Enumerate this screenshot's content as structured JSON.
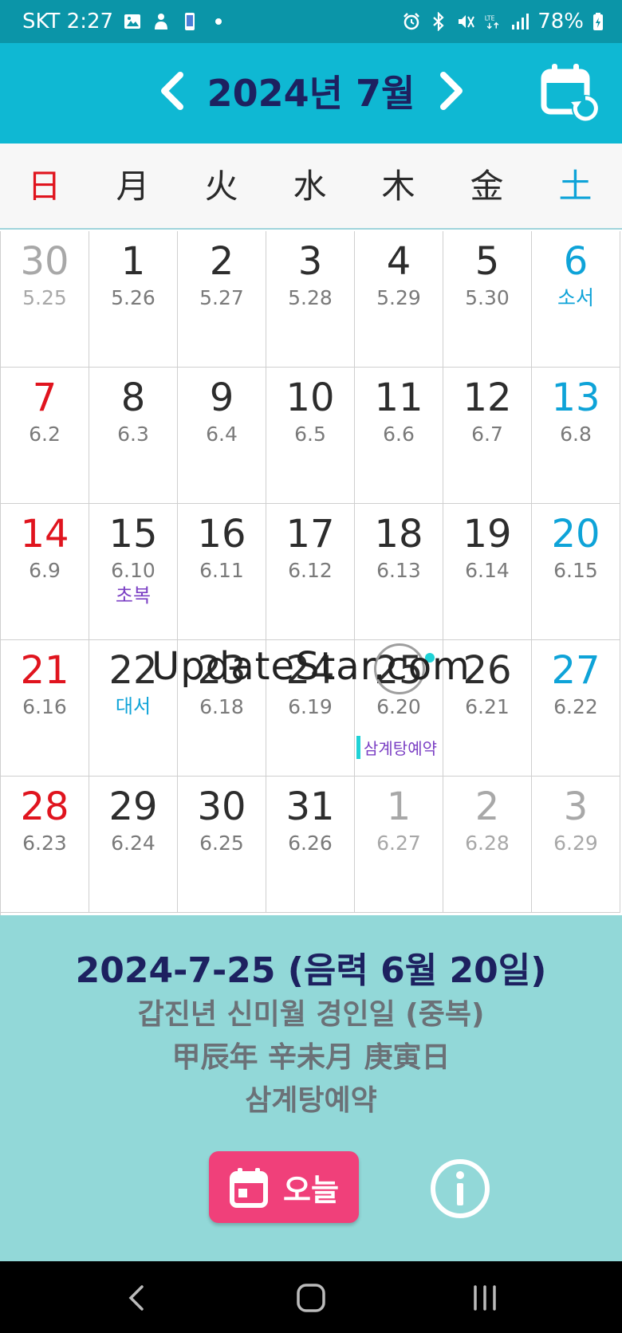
{
  "status_bar": {
    "carrier_time": "SKT 2:27",
    "left_icons": [
      "image-icon",
      "notification-icon",
      "phone-icon",
      "dot-icon"
    ],
    "right_icons": [
      "alarm-icon",
      "bluetooth-icon",
      "mute-icon",
      "lte-icon",
      "signal-icon"
    ],
    "battery": "78%"
  },
  "header": {
    "month_title": "2024년 7월"
  },
  "weekdays": [
    "日",
    "月",
    "火",
    "水",
    "木",
    "金",
    "土"
  ],
  "weeks": [
    [
      {
        "day": "30",
        "lunar": "5.25",
        "type": "other"
      },
      {
        "day": "1",
        "lunar": "5.26"
      },
      {
        "day": "2",
        "lunar": "5.27"
      },
      {
        "day": "3",
        "lunar": "5.28"
      },
      {
        "day": "4",
        "lunar": "5.29"
      },
      {
        "day": "5",
        "lunar": "5.30"
      },
      {
        "day": "6",
        "lunar": "소서",
        "type": "sat",
        "lunar_style": "festival"
      }
    ],
    [
      {
        "day": "7",
        "lunar": "6.2",
        "type": "sun"
      },
      {
        "day": "8",
        "lunar": "6.3"
      },
      {
        "day": "9",
        "lunar": "6.4"
      },
      {
        "day": "10",
        "lunar": "6.5"
      },
      {
        "day": "11",
        "lunar": "6.6"
      },
      {
        "day": "12",
        "lunar": "6.7"
      },
      {
        "day": "13",
        "lunar": "6.8",
        "type": "sat"
      }
    ],
    [
      {
        "day": "14",
        "lunar": "6.9",
        "type": "sun"
      },
      {
        "day": "15",
        "lunar": "6.10",
        "note": "초복",
        "note_color": "purple"
      },
      {
        "day": "16",
        "lunar": "6.11"
      },
      {
        "day": "17",
        "lunar": "6.12"
      },
      {
        "day": "18",
        "lunar": "6.13"
      },
      {
        "day": "19",
        "lunar": "6.14"
      },
      {
        "day": "20",
        "lunar": "6.15",
        "type": "sat"
      }
    ],
    [
      {
        "day": "21",
        "lunar": "6.16",
        "type": "sun"
      },
      {
        "day": "22",
        "lunar": "",
        "note": "대서",
        "note_color": "blue"
      },
      {
        "day": "23",
        "lunar": "6.18"
      },
      {
        "day": "24",
        "lunar": "6.19"
      },
      {
        "day": "25",
        "lunar": "6.20",
        "selected": true,
        "event": "삼계탕예약"
      },
      {
        "day": "26",
        "lunar": "6.21"
      },
      {
        "day": "27",
        "lunar": "6.22",
        "type": "sat"
      }
    ],
    [
      {
        "day": "28",
        "lunar": "6.23",
        "type": "sun"
      },
      {
        "day": "29",
        "lunar": "6.24"
      },
      {
        "day": "30",
        "lunar": "6.25"
      },
      {
        "day": "31",
        "lunar": "6.26"
      },
      {
        "day": "1",
        "lunar": "6.27",
        "type": "other"
      },
      {
        "day": "2",
        "lunar": "6.28",
        "type": "other"
      },
      {
        "day": "3",
        "lunar": "6.29",
        "type": "other"
      }
    ]
  ],
  "watermark": "UpdateStar.com",
  "info": {
    "date": "2024-7-25  (음력 6월 20일)",
    "ganji_korean": "갑진년 신미월 경인일 (중복)",
    "ganji_hanja": "甲辰年 辛未月 庚寅日",
    "event": "삼계탕예약",
    "today_label": "오늘"
  },
  "colors": {
    "status_bar": "#0b95a8",
    "header": "#0fb8d3",
    "title": "#1d2160",
    "sunday": "#e0141e",
    "saturday": "#0ea3d8",
    "info_panel": "#92d8d8",
    "today_button": "#f0407a",
    "event_marker": "#1fd2d6"
  },
  "nav_bar": {
    "icons": [
      "back-icon",
      "home-icon",
      "recents-icon"
    ]
  }
}
